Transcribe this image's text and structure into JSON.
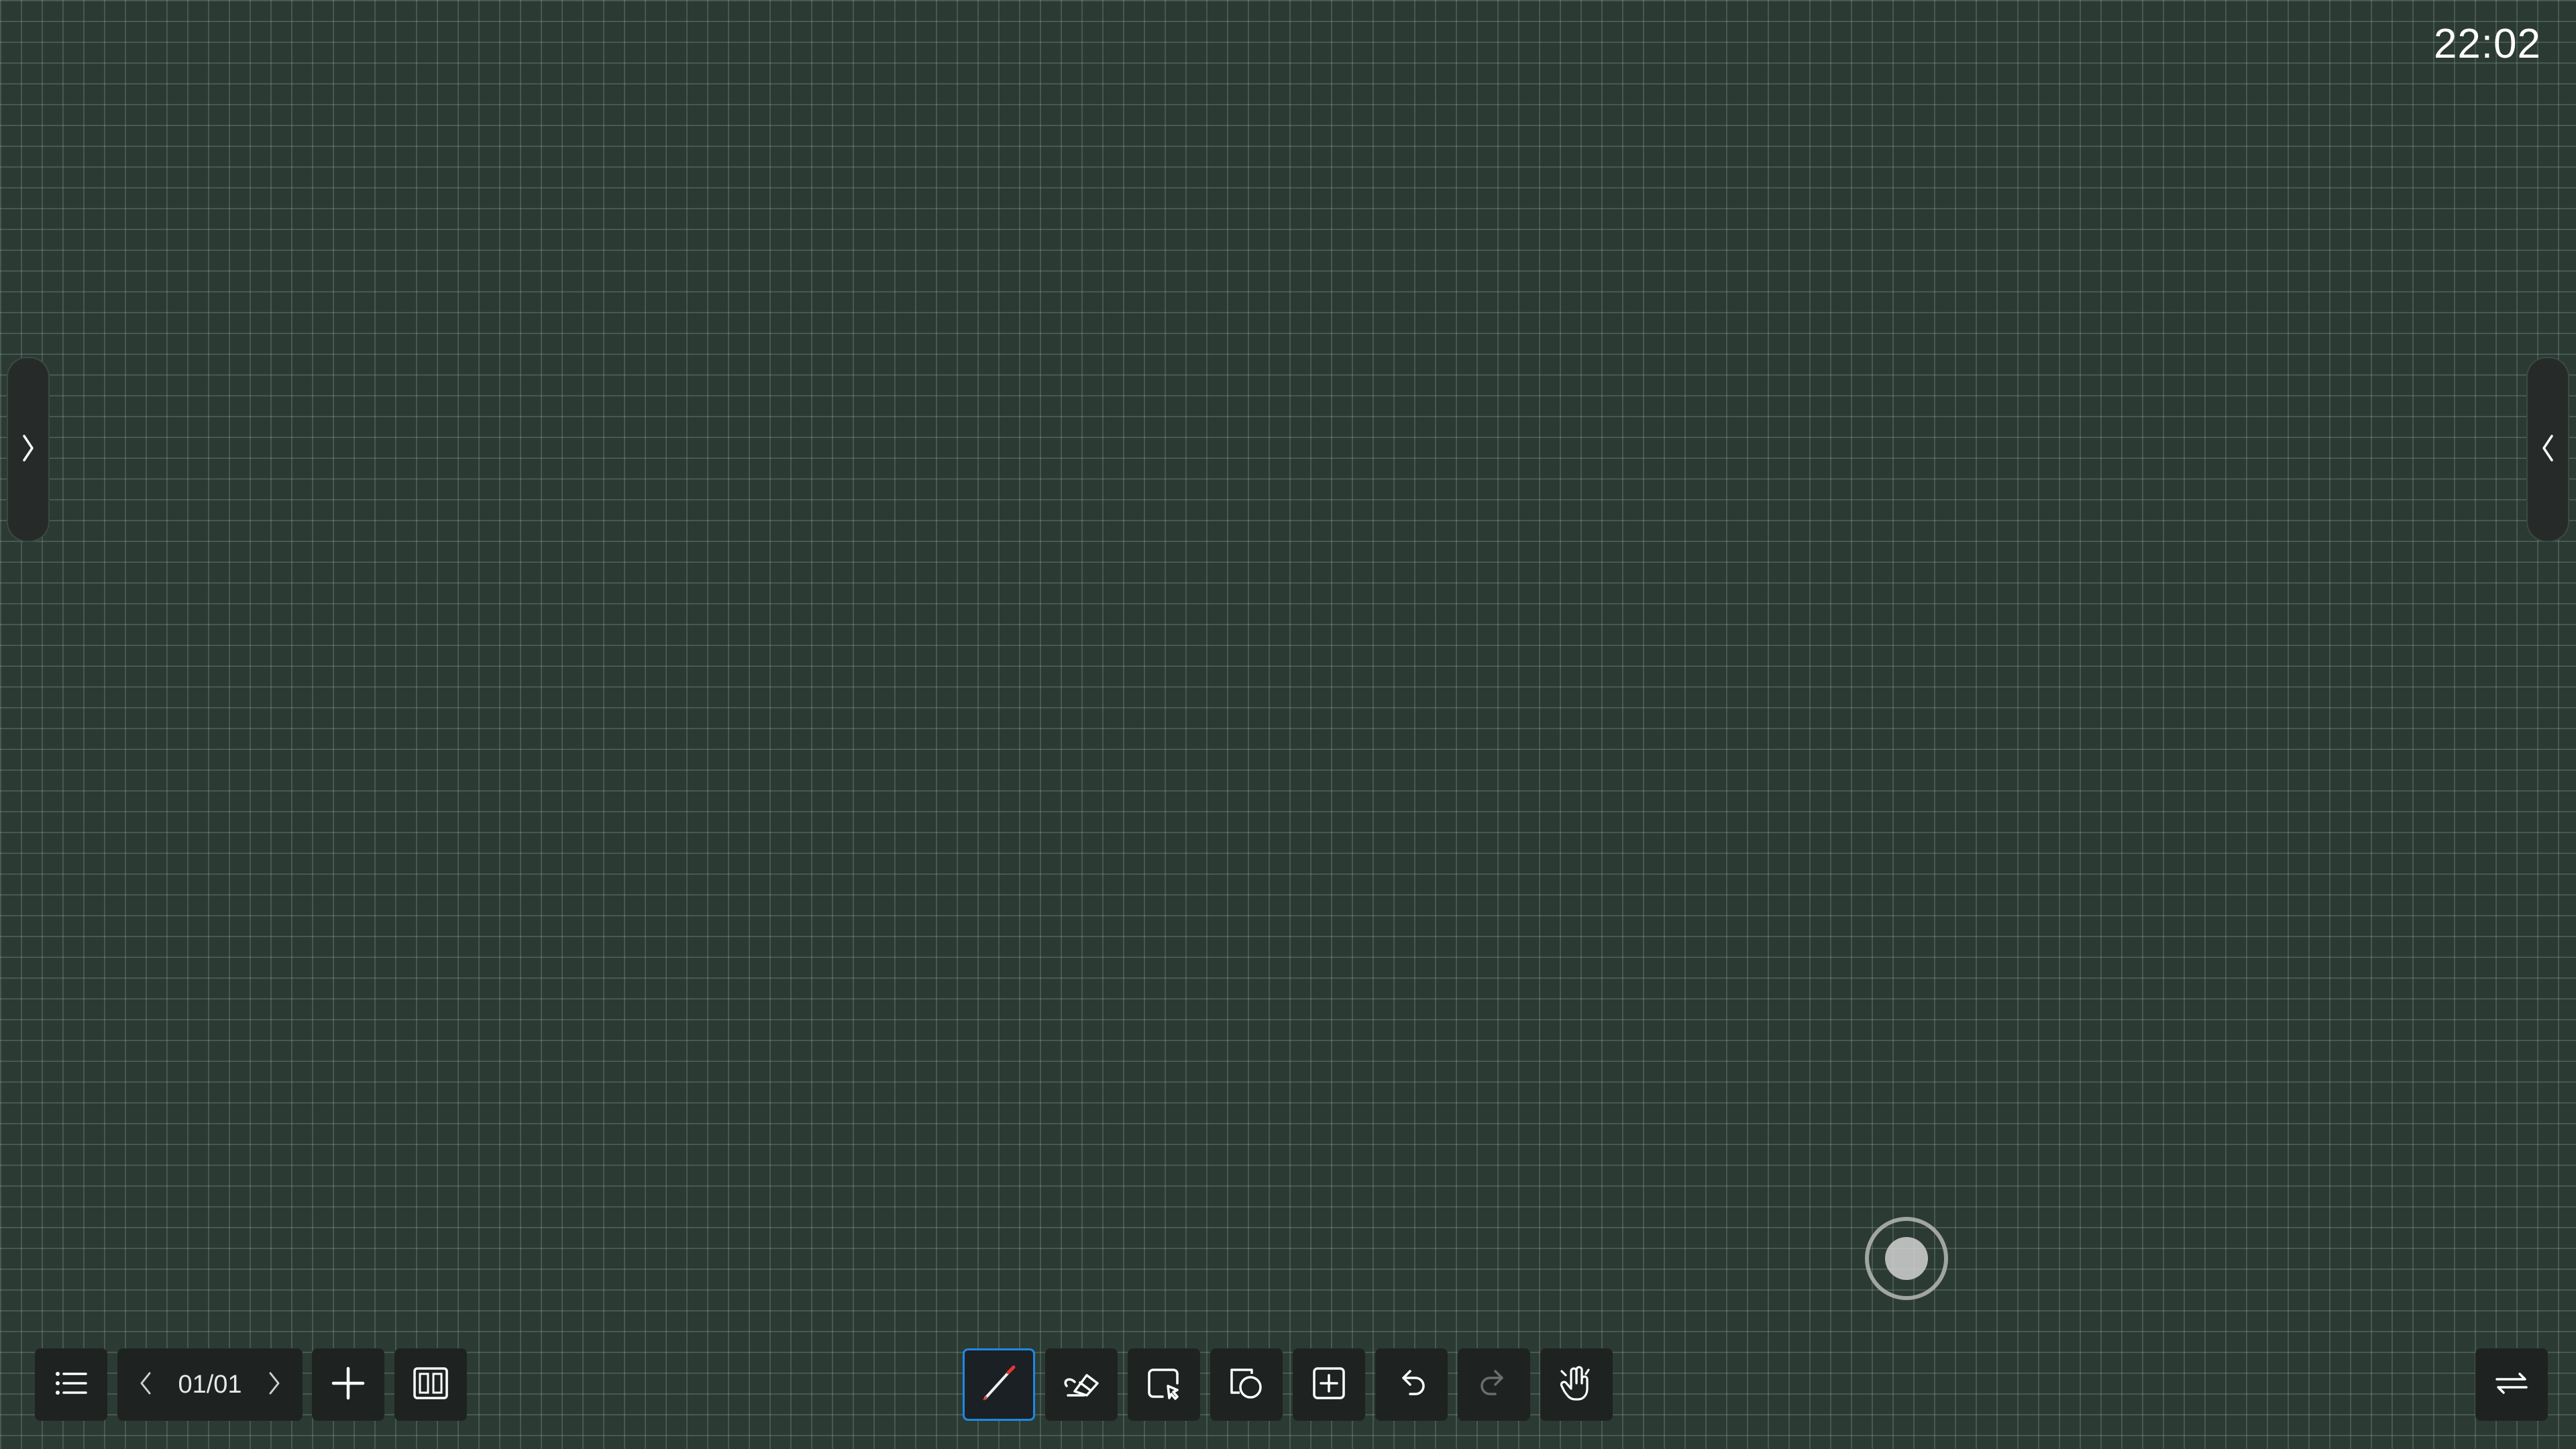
{
  "status": {
    "clock": "22:02"
  },
  "canvas": {
    "background_color": "#2b3a33",
    "grid_color": "#5f7a6d"
  },
  "side_panels": {
    "left_icon": "chevron-right-icon",
    "right_icon": "chevron-left-icon"
  },
  "pager": {
    "page_indicator": "01/01"
  },
  "toolbar_left": [
    {
      "name": "page-list-button",
      "icon": "list-icon"
    },
    {
      "name": "prev-page-button",
      "icon": "chevron-left-icon"
    },
    {
      "name": "next-page-button",
      "icon": "chevron-right-icon"
    },
    {
      "name": "add-page-button",
      "icon": "plus-icon"
    },
    {
      "name": "page-layout-button",
      "icon": "columns-icon"
    }
  ],
  "toolbar_center": [
    {
      "name": "pen-tool-button",
      "icon": "pen-icon",
      "active": true
    },
    {
      "name": "eraser-tool-button",
      "icon": "eraser-icon"
    },
    {
      "name": "select-tool-button",
      "icon": "select-icon"
    },
    {
      "name": "shape-tool-button",
      "icon": "shapes-icon"
    },
    {
      "name": "insert-button",
      "icon": "insert-icon"
    },
    {
      "name": "undo-button",
      "icon": "undo-icon"
    },
    {
      "name": "redo-button",
      "icon": "redo-icon"
    },
    {
      "name": "gesture-tool-button",
      "icon": "hand-gesture-icon"
    }
  ],
  "toolbar_right": [
    {
      "name": "switch-toolbar-button",
      "icon": "swap-icon"
    }
  ],
  "floating": {
    "record_icon": "record-icon"
  },
  "colors": {
    "active_accent": "#1e88e5",
    "toolbar_bg": "#1e2321",
    "pen_tip": "#e53935"
  }
}
